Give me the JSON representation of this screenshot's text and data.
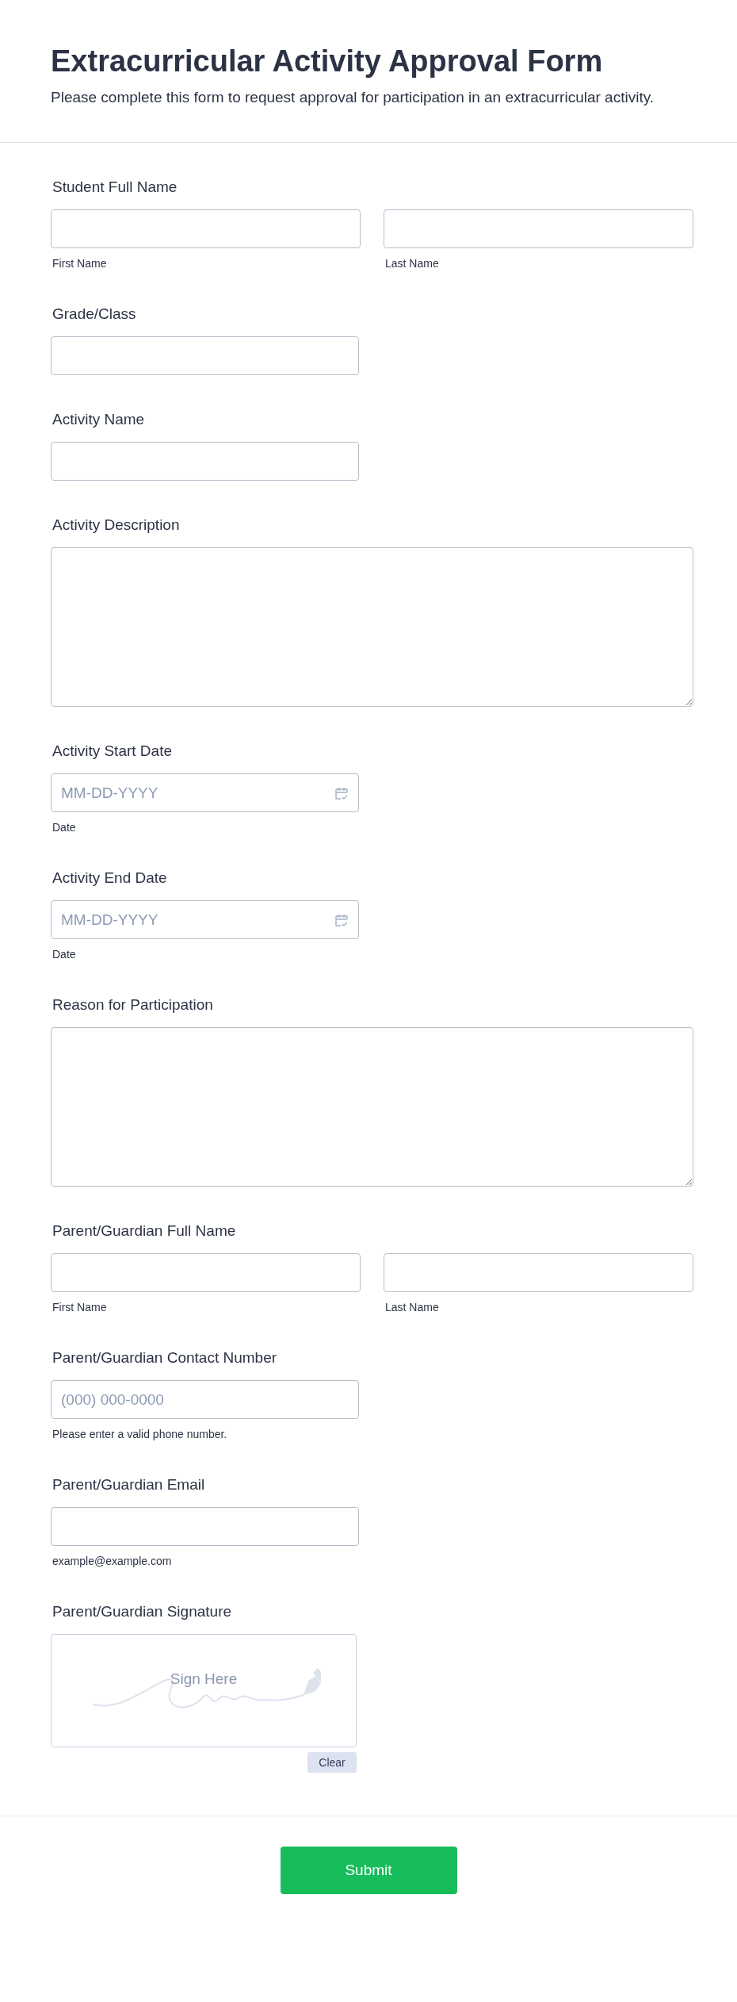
{
  "header": {
    "title": "Extracurricular Activity Approval Form",
    "description": "Please complete this form to request approval for participation in an extracurricular activity."
  },
  "fields": [
    {
      "kind": "name",
      "label": "Student Full Name",
      "inputs": [
        {
          "sublabel": "First Name"
        },
        {
          "sublabel": "Last Name"
        }
      ]
    },
    {
      "kind": "text",
      "label": "Grade/Class"
    },
    {
      "kind": "text",
      "label": "Activity Name"
    },
    {
      "kind": "textarea",
      "label": "Activity Description"
    },
    {
      "kind": "date",
      "label": "Activity Start Date",
      "placeholder": "MM-DD-YYYY",
      "hint": "Date"
    },
    {
      "kind": "date",
      "label": "Activity End Date",
      "placeholder": "MM-DD-YYYY",
      "hint": "Date"
    },
    {
      "kind": "textarea",
      "label": "Reason for Participation"
    },
    {
      "kind": "name",
      "label": "Parent/Guardian Full Name",
      "inputs": [
        {
          "sublabel": "First Name"
        },
        {
          "sublabel": "Last Name"
        }
      ]
    },
    {
      "kind": "phone",
      "label": "Parent/Guardian Contact Number",
      "placeholder": "(000) 000-0000",
      "hint": "Please enter a valid phone number."
    },
    {
      "kind": "email",
      "label": "Parent/Guardian Email",
      "hint": "example@example.com"
    },
    {
      "kind": "signature",
      "label": "Parent/Guardian Signature",
      "placeholder": "Sign Here",
      "clear_button": "Clear"
    }
  ],
  "submit_button": "Submit"
}
